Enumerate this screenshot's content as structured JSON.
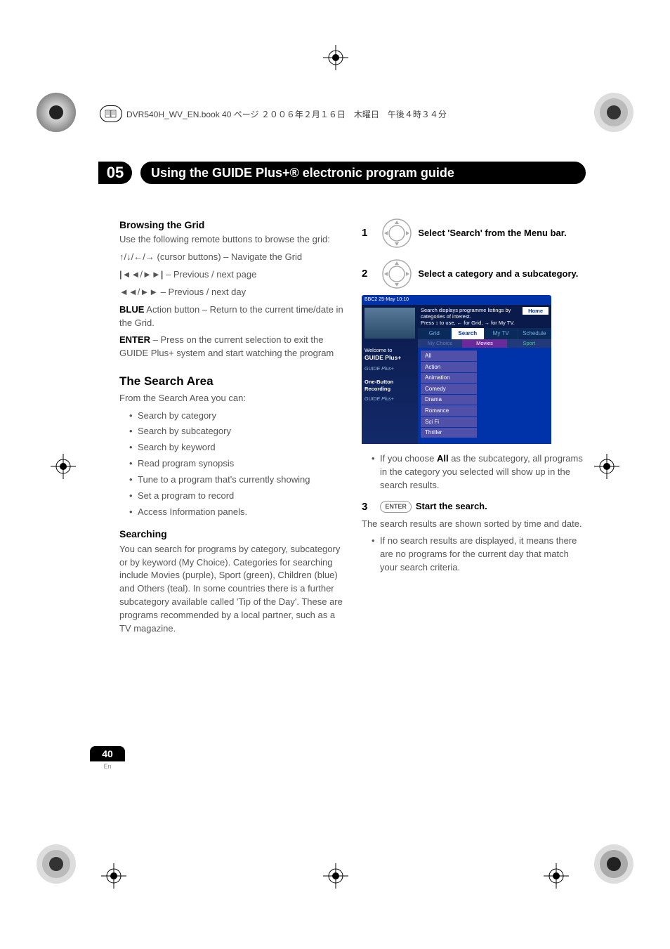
{
  "bookmark": {
    "file": "DVR540H_WV_EN.book  40 ページ  ２００６年２月１６日　木曜日　午後４時３４分"
  },
  "chapter": {
    "num": "05",
    "title": "Using the GUIDE Plus+® electronic program guide"
  },
  "left": {
    "h1": "Browsing the Grid",
    "p1": "Use the following remote buttons to browse the grid:",
    "p2a": "",
    "p2b": " (cursor buttons) – Navigate the Grid",
    "p3": " – Previous / next page",
    "p4": " – Previous / next day",
    "p5a": "BLUE",
    "p5b": " Action button – Return to the current time/date in the Grid.",
    "p6a": "ENTER",
    "p6b": " – Press on the current selection to exit the GUIDE Plus+ system and start watching the program",
    "h2": "The Search Area",
    "p7": "From the Search Area you can:",
    "bullets": [
      "Search by category",
      "Search by subcategory",
      "Search by keyword",
      "Read program synopsis",
      "Tune to a program that's currently showing",
      "Set a program to record",
      "Access Information panels."
    ],
    "h3": "Searching",
    "p8": "You can search for programs by category, subcategory or by keyword (My Choice). Categories for searching include Movies (purple), Sport (green), Children (blue) and Others (teal). In some countries there is a further subcategory available called 'Tip of the Day'. These are programs recommended by a local partner, such as a TV magazine."
  },
  "right": {
    "s1n": "1",
    "s1t": "Select 'Search' from the Menu bar.",
    "s2n": "2",
    "s2t": "Select a category and a subcategory.",
    "s3n": "3",
    "s3t": "Start the search.",
    "enter": "ENTER",
    "after_tv_a": "If you choose ",
    "after_tv_b": "All",
    "after_tv_c": " as the subcategory, all programs in the category you selected will show up in the search results.",
    "p_after3": "The search results are shown sorted by time and date.",
    "bullet3": "If no search results are displayed, it means there are no programs for the current day that match your search criteria."
  },
  "tv": {
    "status": "BBC2   25-May  10:10",
    "home": "Home",
    "msg1": "Search displays programme listings by categories of interest.",
    "msg2": "Press ↕ to use, ← for Grid, → for My TV.",
    "tabs": {
      "grid": "Grid",
      "search": "Search",
      "mytv": "My TV",
      "schedule": "Schedule"
    },
    "subtabs": {
      "mychoice": "My Choice",
      "movies": "Movies",
      "sport": "Sport"
    },
    "items": [
      "All",
      "Action",
      "Animation",
      "Comedy",
      "Drama",
      "Romance",
      "Sci Fi",
      "Thriller"
    ],
    "welcome1": "Welcome to",
    "welcome2": "GUIDE Plus+",
    "ob1": "One-Button",
    "ob2": "Recording"
  },
  "footer": {
    "page": "40",
    "lang": "En"
  }
}
